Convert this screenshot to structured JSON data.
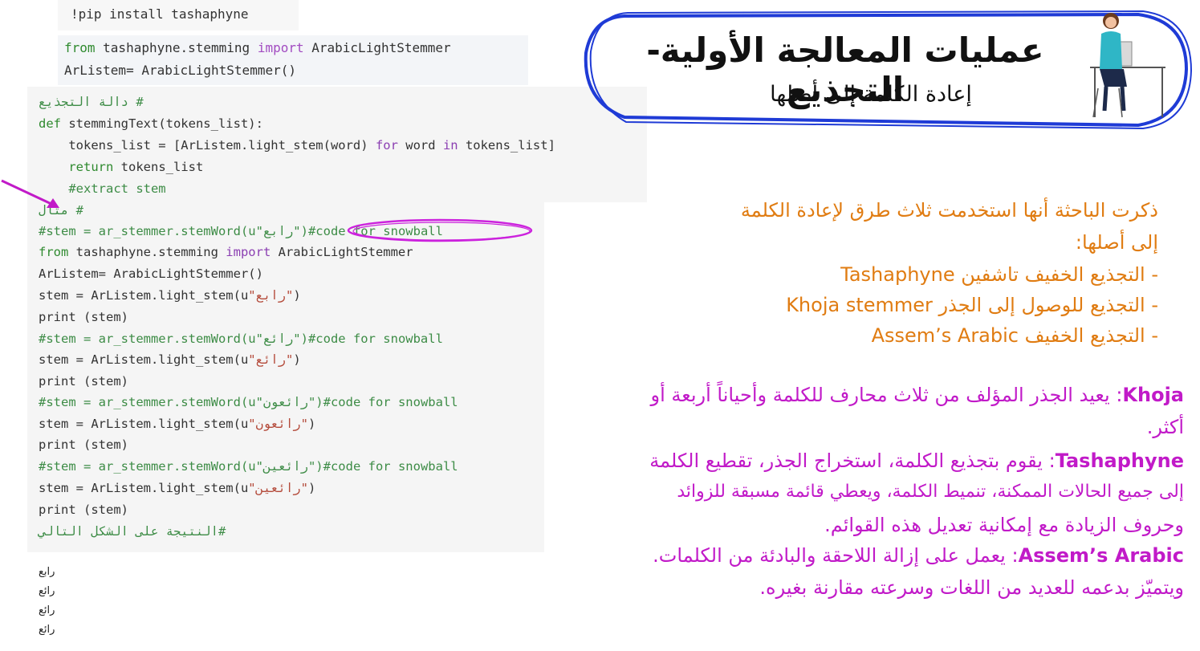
{
  "cells": {
    "pip": "!pip install tashaphyne",
    "import_line1_from": "from",
    "import_line1_mod": " tashaphyne.stemming ",
    "import_line1_import": "import",
    "import_line1_rest": " ArabicLightStemmer",
    "import_line2": "ArListem= ArabicLightStemmer()"
  },
  "code": {
    "l1": "# دالة التجذيع",
    "l2_def": "def",
    "l2_rest": " stemmingText(tokens_list):",
    "l3_a": "    tokens_list = [ArListem.light_stem(word) ",
    "l3_for": "for",
    "l3_b": " word ",
    "l3_in": "in",
    "l3_c": " tokens_list]",
    "l4_return": "    return",
    "l4_rest": " tokens_list",
    "l5": "    #extract stem",
    "l6": "# مثال",
    "l7_a": "#stem = ar_stemmer.stemWord(u\"رابع\")",
    "l7_b": "#code for snowball",
    "l8_from": "from",
    "l8_mod": " tashaphyne.stemming ",
    "l8_import": "import",
    "l8_rest": " ArabicLightStemmer",
    "l9": "ArListem= ArabicLightStemmer()",
    "l10_a": "stem = ArListem.light_stem(u",
    "l10_s": "\"رابع\"",
    "l10_b": ")",
    "l11": "print (stem)",
    "l12": "#stem = ar_stemmer.stemWord(u\"رائع\")#code for snowball",
    "l13_a": "stem = ArListem.light_stem(u",
    "l13_s": "\"رائع\"",
    "l13_b": ")",
    "l14": "print (stem)",
    "l15": "#stem = ar_stemmer.stemWord(u\"رائعون\")#code for snowball",
    "l16_a": "stem = ArListem.light_stem(u",
    "l16_s": "\"رائعون\"",
    "l16_b": ")",
    "l17": "print (stem)",
    "l18": "#stem = ar_stemmer.stemWord(u\"رائعين\")#code for snowball",
    "l19_a": "stem = ArListem.light_stem(u",
    "l19_s": "\"رائعين\"",
    "l19_b": ")",
    "l20": "print (stem)",
    "l21": "#النتيجة على الشكل التالي"
  },
  "output": [
    "رابع",
    "رائع",
    "رائع",
    "رائع"
  ],
  "title": {
    "main": "عمليات المعالجة الأولية- التجذيع",
    "sub": "إعادة الكلمة إلى أصلها"
  },
  "right": {
    "intro1": "ذكرت الباحثة أنها استخدمت ثلاث طرق لإعادة الكلمة",
    "intro2": "إلى أصلها:",
    "b1": "-    التجذيع الخفيف تاشفين Tashaphyne",
    "b2": "-    التجذيع للوصول إلى الجذر Khoja stemmer",
    "b3": "-    التجذيع الخفيف Assem’s Arabic",
    "khoja_name": "Khoja",
    "khoja_text1": ": يعيد الجذر المؤلف من ثلاث محارف للكلمة وأحياناً أربعة أو",
    "khoja_text2": "أكثر.",
    "tash_name": "Tashaphyne",
    "tash_text1": ": يقوم بتجذيع الكلمة، استخراج الجذر، تقطيع الكلمة",
    "tash_text2": "إلى جميع الحالات الممكنة، تنميط الكلمة، ويعطي قائمة مسبقة للزوائد",
    "tash_text3": "وحروف الزيادة مع إمكانية تعديل هذه القوائم.",
    "assem_name": "Assem’s Arabic",
    "assem_text1": ": يعمل على إزالة اللاحقة والبادئة من الكلمات.",
    "assem_text2": "ويتميّز بدعمه للعديد من اللغات وسرعته مقارنة بغيره."
  },
  "colors": {
    "intro": "#e07c12",
    "description": "#c11ac8",
    "highlight": "#cc22dd"
  }
}
